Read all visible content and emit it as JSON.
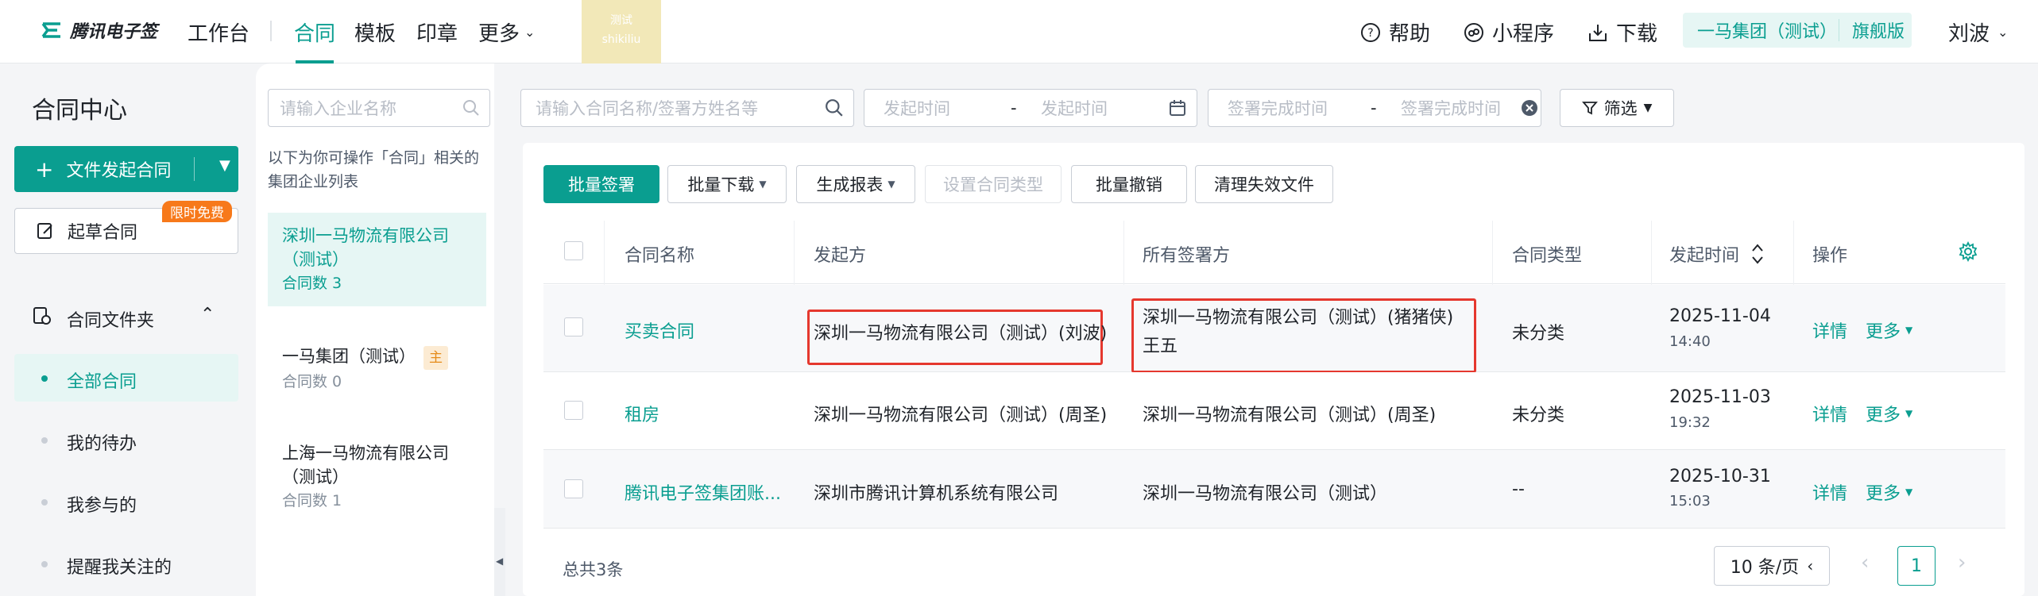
{
  "topbar": {
    "logo_text": "腾讯电子签",
    "nav": [
      "工作台",
      "合同",
      "模板",
      "印章",
      "更多"
    ],
    "watermark_line1": "测试",
    "watermark_line2": "shikiliu",
    "help": "帮助",
    "miniprogram": "小程序",
    "download": "下载",
    "org_name": "一马集团（测试）",
    "edition": "旗舰版",
    "user": "刘波"
  },
  "sidebar": {
    "title": "合同中心",
    "initiate_button": "文件发起合同",
    "draft_button": "起草合同",
    "free_badge": "限时免费",
    "folder_label": "合同文件夹",
    "items": [
      "全部合同",
      "我的待办",
      "我参与的",
      "提醒我关注的"
    ]
  },
  "midpanel": {
    "search_placeholder": "请输入企业名称",
    "note": "以下为你可操作「合同」相关的集团企业列表",
    "companies": [
      {
        "name": "深圳一马物流有限公司（测试）",
        "count": "合同数 3"
      },
      {
        "name": "一马集团（测试）",
        "tag": "主",
        "count": "合同数 0"
      },
      {
        "name": "上海一马物流有限公司（测试）",
        "count": "合同数 1"
      }
    ]
  },
  "filters": {
    "search_placeholder": "请输入合同名称/签署方姓名等",
    "start_from": "发起时间",
    "start_sep": "-",
    "start_to": "发起时间",
    "done_from": "签署完成时间",
    "done_sep": "-",
    "done_to": "签署完成时间",
    "filter_button": "筛选"
  },
  "toolbar": {
    "batch_sign": "批量签署",
    "batch_download": "批量下载",
    "gen_report": "生成报表",
    "set_type": "设置合同类型",
    "batch_revoke": "批量撤销",
    "clean_invalid": "清理失效文件"
  },
  "table": {
    "headers": [
      "合同名称",
      "发起方",
      "所有签署方",
      "合同类型",
      "发起时间",
      "操作"
    ],
    "rows": [
      {
        "name": "买卖合同",
        "initiator": "深圳一马物流有限公司（测试）(刘波)",
        "signers_1": "深圳一马物流有限公司（测试）(猪猪侠)",
        "signers_2": "王五",
        "type": "未分类",
        "date": "2025-11-04",
        "time": "14:40",
        "detail": "详情",
        "more": "更多"
      },
      {
        "name": "租房",
        "initiator": "深圳一马物流有限公司（测试）(周圣)",
        "signers_1": "深圳一马物流有限公司（测试）(周圣)",
        "signers_2": "",
        "type": "未分类",
        "date": "2025-11-03",
        "time": "19:32",
        "detail": "详情",
        "more": "更多"
      },
      {
        "name": "腾讯电子签集团账...",
        "initiator": "深圳市腾讯计算机系统有限公司",
        "signers_1": "深圳一马物流有限公司（测试）",
        "signers_2": "",
        "type": "--",
        "date": "2025-10-31",
        "time": "15:03",
        "detail": "详情",
        "more": "更多"
      }
    ]
  },
  "pagination": {
    "total": "总共3条",
    "page_size": "10 条/页",
    "current_page": "1"
  },
  "colors": {
    "brand": "#0a9e90",
    "highlight_box": "#e5382e",
    "free_badge": "#f7791a"
  }
}
